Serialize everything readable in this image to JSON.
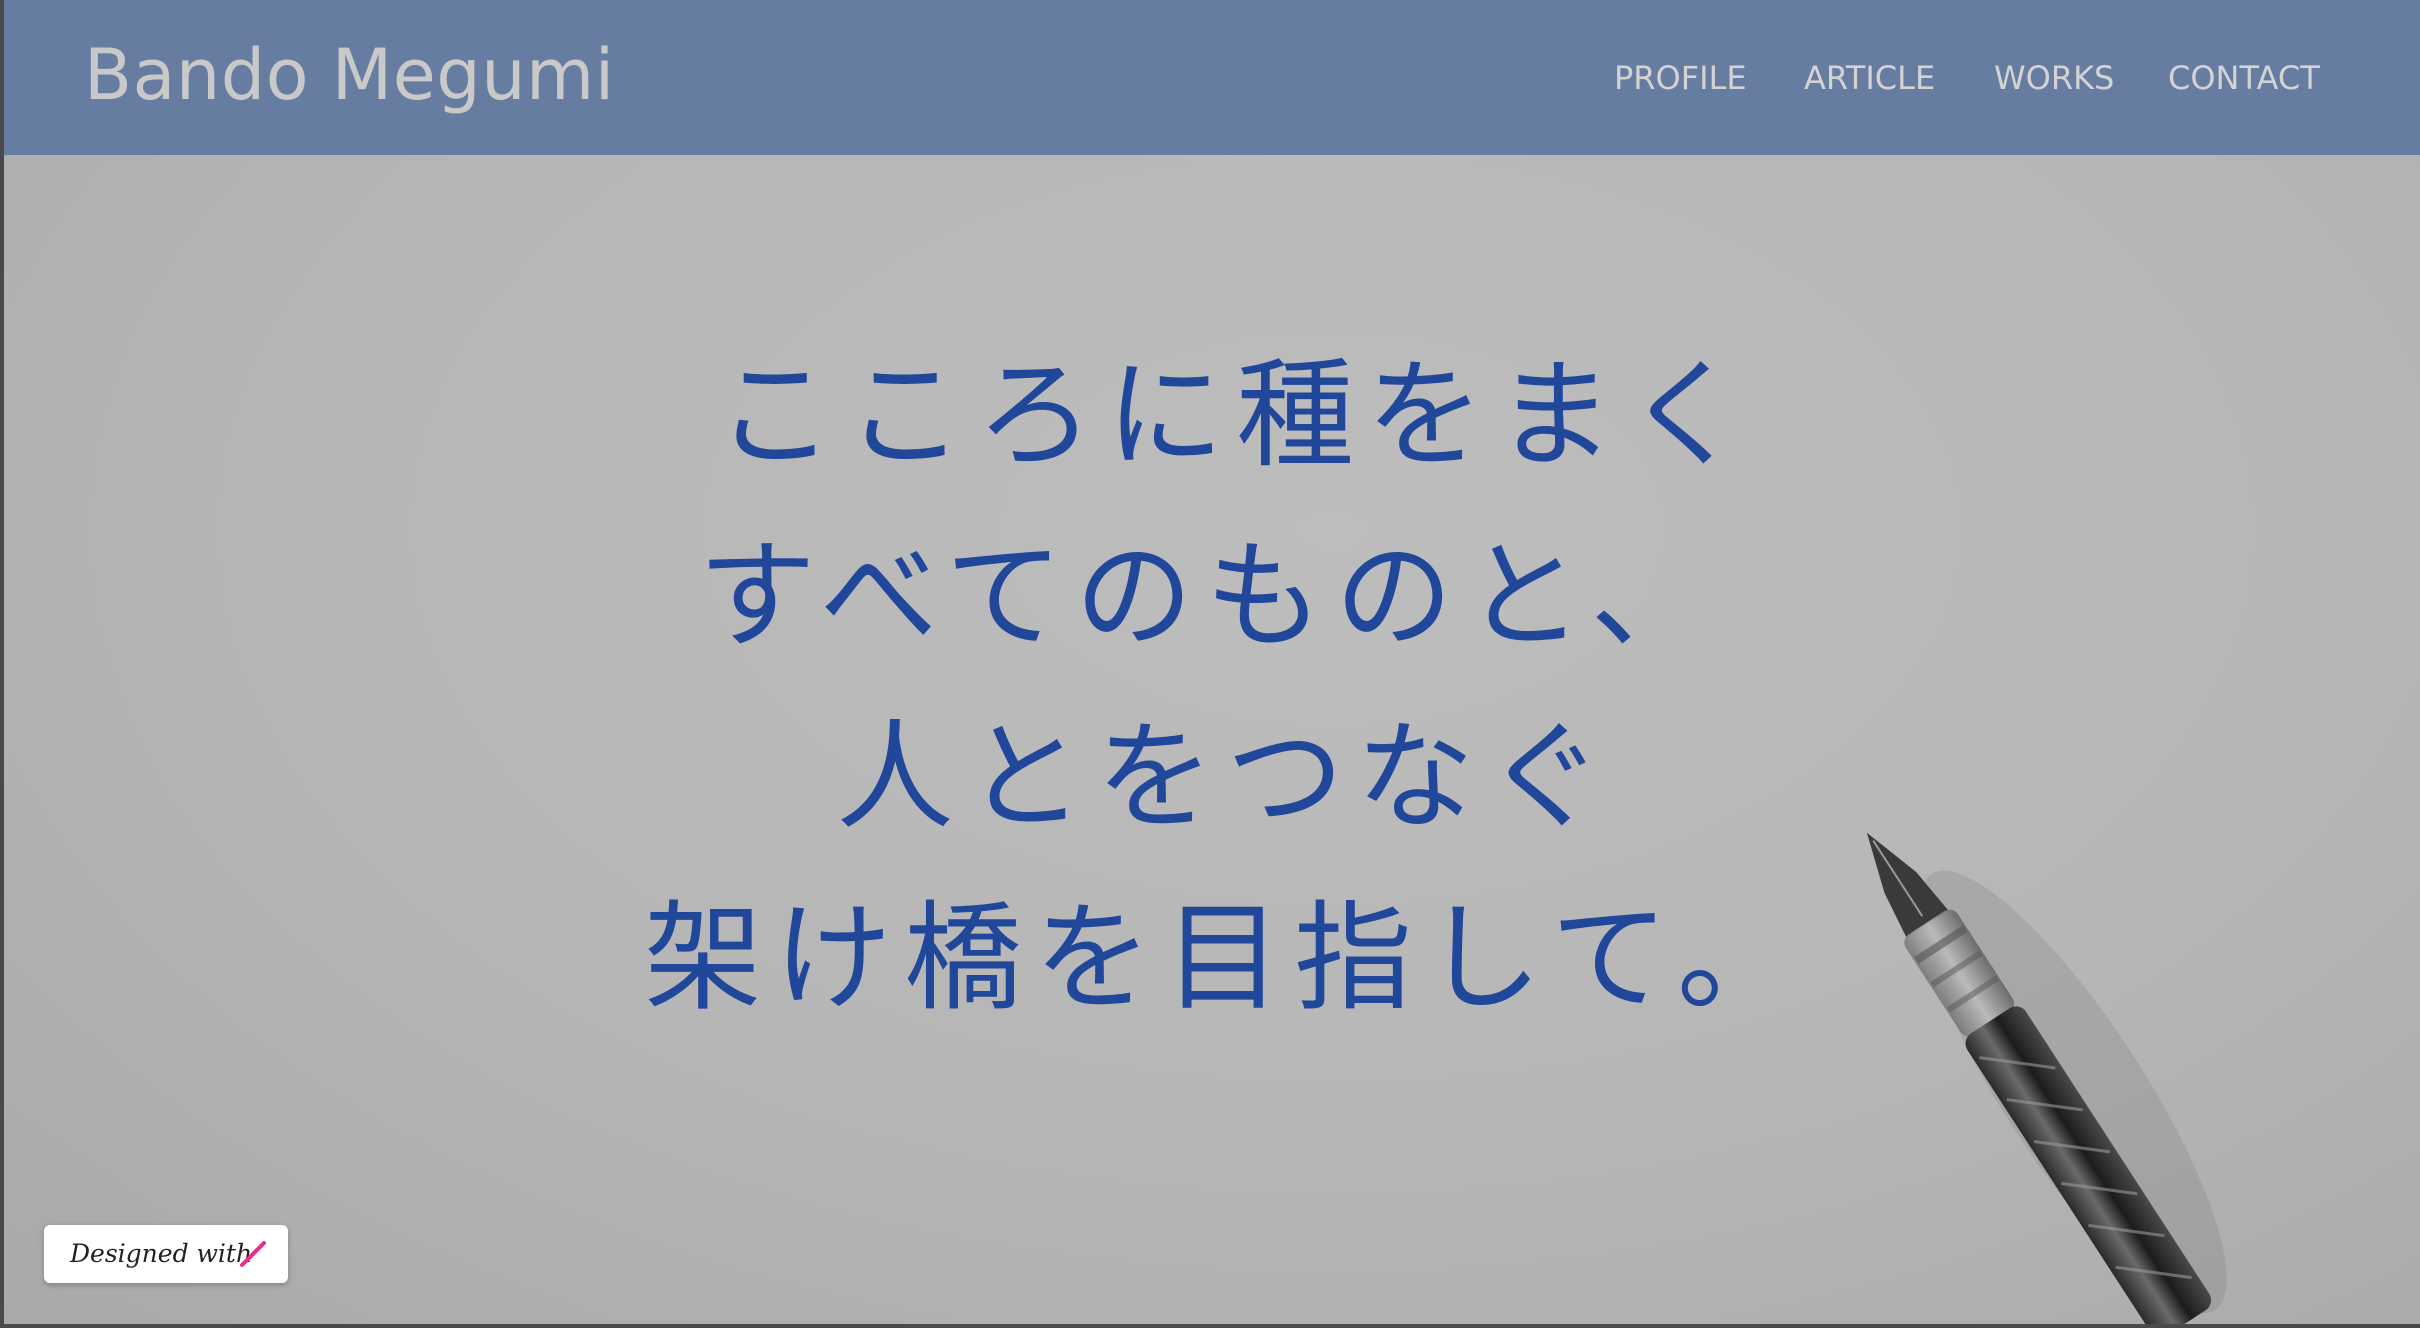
{
  "site": {
    "brand": "Bando Megumi"
  },
  "nav": {
    "items": [
      {
        "label": "PROFILE"
      },
      {
        "label": "ARTICLE"
      },
      {
        "label": "WORKS"
      },
      {
        "label": "CONTACT"
      }
    ]
  },
  "hero": {
    "lines": [
      "こころに種をまく",
      "すべてのものと、",
      "人とをつなぐ",
      "架け橋を目指して。"
    ]
  },
  "badge": {
    "text": "Designed with",
    "icon": "pen-stroke-icon"
  },
  "colors": {
    "header": "#677ca1",
    "hero_text": "#21479a",
    "nav_text": "#d3d3d3",
    "badge_icon": "#e0318a"
  }
}
